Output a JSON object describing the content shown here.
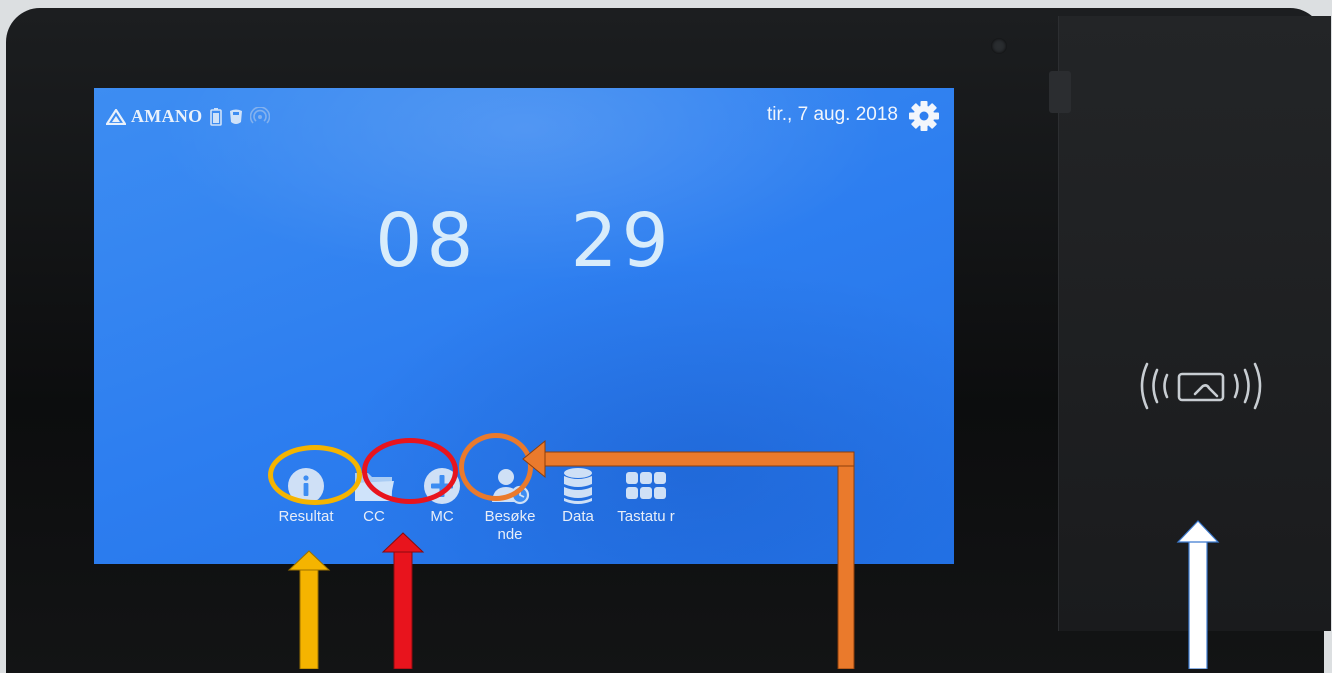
{
  "brand": {
    "name": "AMANO",
    "icons": [
      "battery-icon",
      "card-holder-icon",
      "wireless-icon"
    ]
  },
  "status": {
    "date": "tir., 7 aug. 2018",
    "settings_icon": "gear-icon"
  },
  "clock": {
    "hours": "08",
    "minutes": "29"
  },
  "menu": {
    "items": [
      {
        "label": "Resultat",
        "icon": "info-icon"
      },
      {
        "label": "CC",
        "icon": "folder-icon"
      },
      {
        "label": "MC",
        "icon": "plus-icon"
      },
      {
        "label": "Besøke nde",
        "icon": "visitor-clock-icon"
      },
      {
        "label": "Data",
        "icon": "database-icon"
      },
      {
        "label": "Tastatu r",
        "icon": "keypad-icon"
      }
    ]
  },
  "reader": {
    "icon": "contactless-card-icon"
  },
  "annotations": {
    "colors": {
      "yellow": "#f5b400",
      "red": "#e8141d",
      "orange": "#ea7a2c",
      "blue": "#3d7bd0"
    },
    "circles": [
      "resultat",
      "cc",
      "mc"
    ],
    "arrows": [
      "yellow-arrow",
      "red-arrow",
      "orange-arrow",
      "white-arrow"
    ]
  }
}
